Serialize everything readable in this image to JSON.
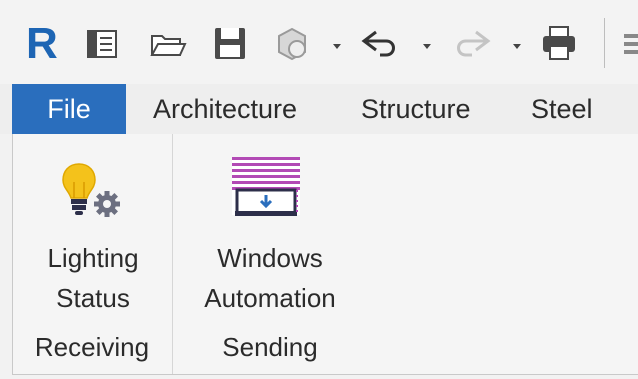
{
  "app": {
    "logo_letter": "R"
  },
  "quick_access_toolbar": {
    "icons": [
      "revit-logo-icon",
      "properties-icon",
      "open-icon",
      "save-icon",
      "sync-icon",
      "undo-icon",
      "redo-icon",
      "print-icon"
    ]
  },
  "tabs": [
    {
      "label": "File",
      "active": true
    },
    {
      "label": "Architecture"
    },
    {
      "label": "Structure"
    },
    {
      "label": "Steel"
    }
  ],
  "ribbon": {
    "panels": [
      {
        "title": "Receiving",
        "buttons": [
          {
            "label_line1": "Lighting",
            "label_line2": "Status",
            "icon": "lightbulb-gear-icon"
          }
        ]
      },
      {
        "title": "Sending",
        "buttons": [
          {
            "label_line1": "Windows",
            "label_line2": "Automation",
            "icon": "window-blinds-icon"
          }
        ]
      }
    ]
  },
  "colors": {
    "accent": "#2a6ebd",
    "logo_blue": "#1d65b4",
    "bulb_yellow": "#f4c21b",
    "blinds_purple": "#b24ab5",
    "gear_gray": "#6c6f80"
  }
}
